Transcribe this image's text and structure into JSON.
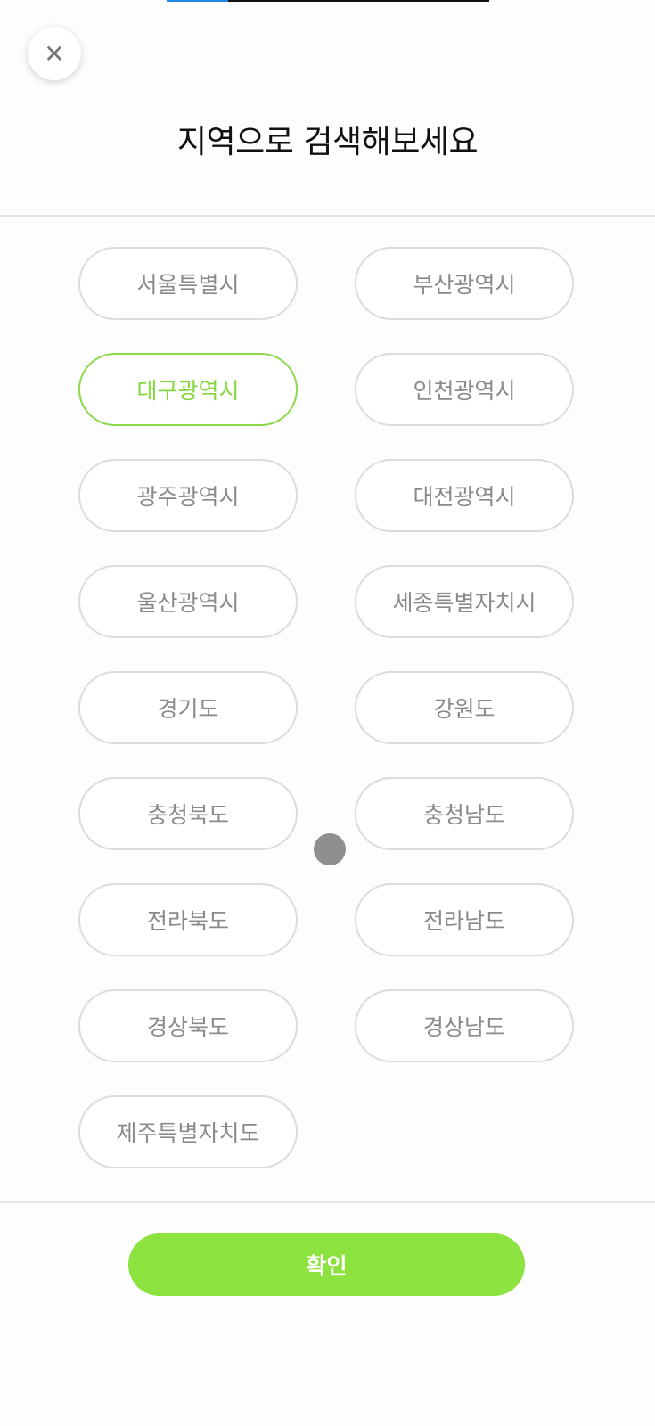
{
  "progress": {
    "value_fraction": 0.19
  },
  "close_button": {
    "icon": "close-icon",
    "glyph": "✕"
  },
  "header": {
    "title": "지역으로 검색해보세요"
  },
  "regions": [
    {
      "label": "서울특별시",
      "selected": false
    },
    {
      "label": "부산광역시",
      "selected": false
    },
    {
      "label": "대구광역시",
      "selected": true
    },
    {
      "label": "인천광역시",
      "selected": false
    },
    {
      "label": "광주광역시",
      "selected": false
    },
    {
      "label": "대전광역시",
      "selected": false
    },
    {
      "label": "울산광역시",
      "selected": false
    },
    {
      "label": "세종특별자치시",
      "selected": false
    },
    {
      "label": "경기도",
      "selected": false
    },
    {
      "label": "강원도",
      "selected": false
    },
    {
      "label": "충청북도",
      "selected": false
    },
    {
      "label": "충청남도",
      "selected": false
    },
    {
      "label": "전라북도",
      "selected": false
    },
    {
      "label": "전라남도",
      "selected": false
    },
    {
      "label": "경상북도",
      "selected": false
    },
    {
      "label": "경상남도",
      "selected": false
    },
    {
      "label": "제주특별자치도",
      "selected": false
    }
  ],
  "footer": {
    "confirm_label": "확인"
  },
  "colors": {
    "accent": "#8ce23e",
    "selected_text": "#86d63f",
    "button_border": "#dcdcdc",
    "button_text": "#8a8a8a"
  }
}
